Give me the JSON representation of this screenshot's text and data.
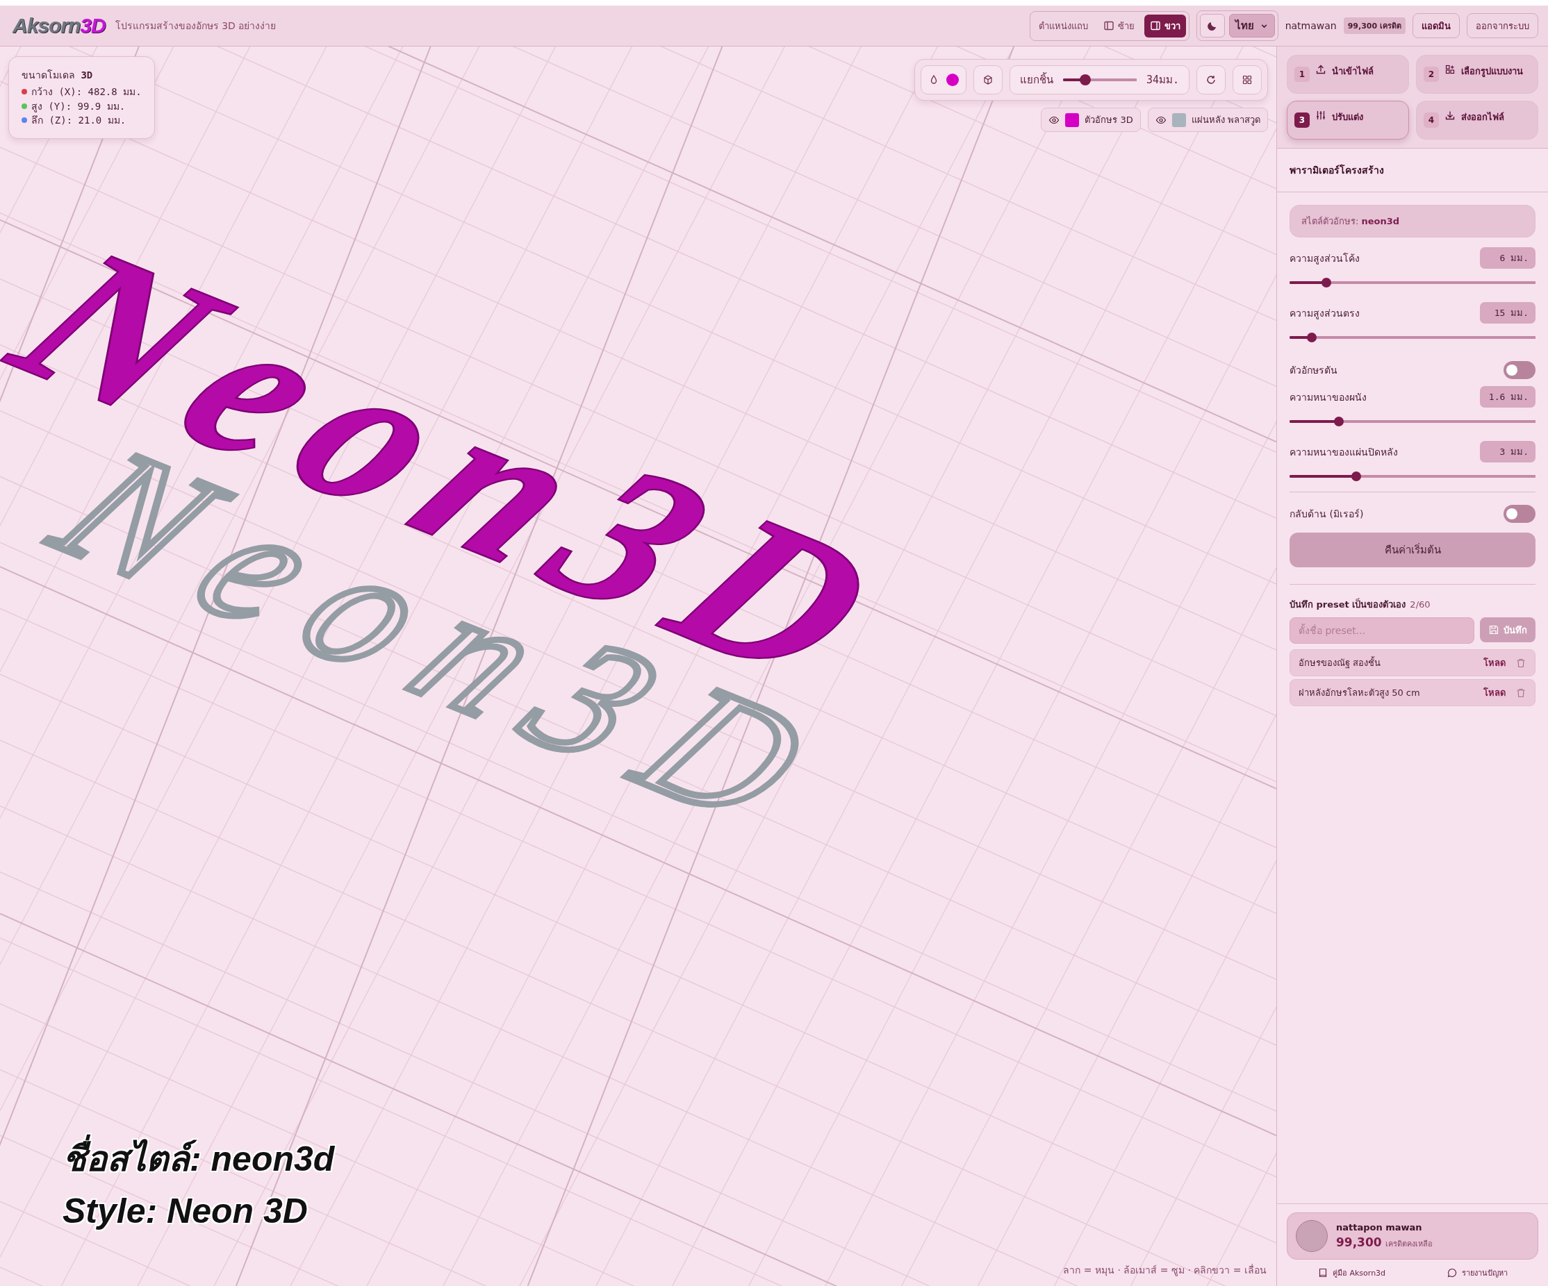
{
  "header": {
    "logo": {
      "word": "Aksorn",
      "accent": "3D"
    },
    "tagline": "โปรแกรมสร้างของอักษร 3D อย่างง่าย",
    "sidebar_position": {
      "label": "ตำแหน่งแถบ",
      "options": [
        {
          "label": "ซ้าย",
          "selected": false
        },
        {
          "label": "ขวา",
          "selected": true
        }
      ]
    },
    "dark_mode": false,
    "language": "ไทย",
    "username": "natmawan",
    "credits": "99,300 เครดิต",
    "admin_button": "แอดมิน",
    "logout_button": "ออกจากระบบ"
  },
  "viewport": {
    "dimensions": {
      "title": "ขนาดโมเดล ",
      "title_bold": "3D",
      "rows": [
        {
          "text": "กว้าง (X): 482.8 มม.",
          "color": "#d9414b"
        },
        {
          "text": "สูง (Y): 99.9 มม.",
          "color": "#5cc35c"
        },
        {
          "text": "ลึก (Z): 21.0 มม.",
          "color": "#5b86f0"
        }
      ]
    },
    "toolbar": {
      "color": "#d600c4",
      "separate": {
        "label": "แยกชิ้น",
        "level": 0.3,
        "reading": "34มม."
      }
    },
    "layers": [
      {
        "label": "ตัวอักษร 3D",
        "color": "#d600c4",
        "visible": true
      },
      {
        "label": "แผ่นหลัง พลาสวูด",
        "color": "#a9b3bd",
        "visible": true
      }
    ],
    "model": {
      "letters_text": "Neon3D",
      "backplate_text": "Neon3D"
    },
    "caption": [
      "ชื่อสไตล์: neon3d",
      "Style: Neon 3D"
    ],
    "hint": "ลาก = หมุน · ล้อเมาส์ = ซูม · คลิกขวา = เลื่อน"
  },
  "sidebar": {
    "steps": [
      {
        "number": "1",
        "label": "นำเข้าไฟล์",
        "selected": false
      },
      {
        "number": "2",
        "label": "เลือกรูปแบบงาน",
        "selected": false
      },
      {
        "number": "3",
        "label": "ปรับแต่ง",
        "selected": true
      },
      {
        "number": "4",
        "label": "ส่งออกไฟล์",
        "selected": false
      }
    ],
    "section_title": "พารามิเตอร์โครงสร้าง",
    "style_label": "สไตล์ตัวอักษร: ",
    "style_value": "neon3d",
    "params": [
      {
        "kind": "slider",
        "label": "ความสูงส่วนโค้ง",
        "value": "6 มม.",
        "level": 0.15
      },
      {
        "kind": "slider",
        "label": "ความสูงส่วนตรง",
        "value": "15 มม.",
        "level": 0.09
      },
      {
        "kind": "toggle",
        "label": "ตัวอักษรตัน",
        "on": false
      },
      {
        "kind": "slider",
        "label": "ความหนาของผนัง",
        "value": "1.6 มม.",
        "level": 0.2
      },
      {
        "kind": "slider",
        "label": "ความหนาของแผ่นปิดหลัง",
        "value": "3 มม.",
        "level": 0.27
      },
      {
        "kind": "divider"
      },
      {
        "kind": "toggle",
        "label": "กลับด้าน (มิเรอร์)",
        "on": false
      }
    ],
    "reset_button": "คืนค่าเริ่มต้น",
    "presets": {
      "title": "บันทึก preset เป็นของตัวเอง",
      "count": "2/60",
      "placeholder": "ตั้งชื่อ preset...",
      "save_button": "บันทึก",
      "items": [
        {
          "name": "อักษรของณัฐ สองชั้น",
          "load": "โหลด"
        },
        {
          "name": "ฝาหลังอักษรโลหะตัวสูง 50 cm",
          "load": "โหลด"
        }
      ]
    },
    "user": {
      "name": "nattapon mawan",
      "credits": "99,300",
      "credits_label": "เครดิตคงเหลือ"
    },
    "links": [
      {
        "label": "คู่มือ Aksorn3d"
      },
      {
        "label": "รายงานปัญหา"
      }
    ]
  }
}
